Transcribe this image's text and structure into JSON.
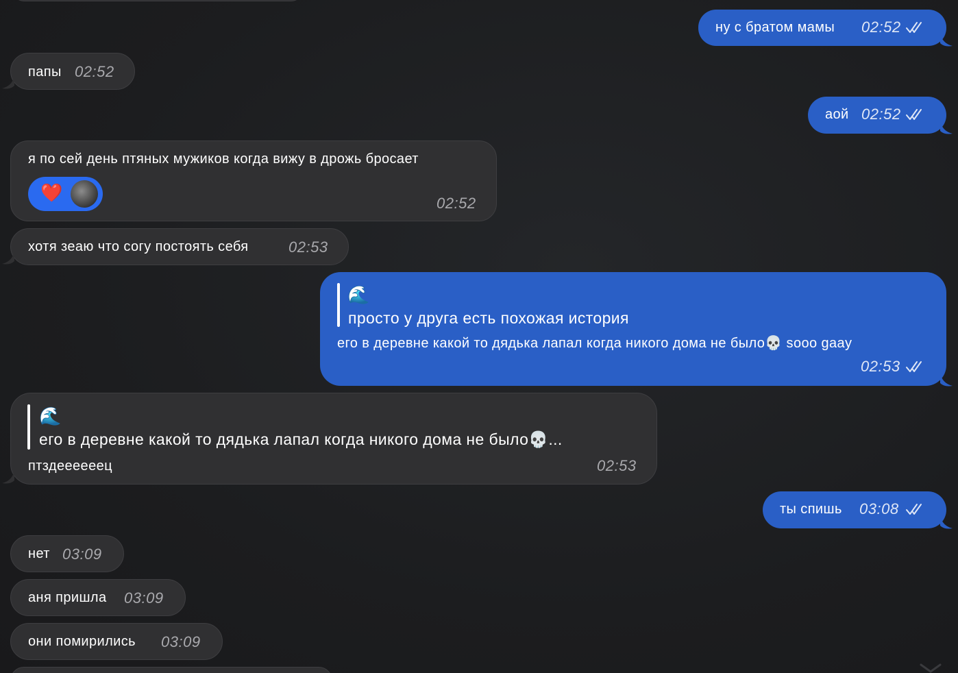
{
  "colors": {
    "background": "#1c1d1f",
    "incoming_bubble": "#303032",
    "outgoing_bubble": "#2a5fc6",
    "reaction_pill": "#2a6af0",
    "timestamp_in": "#a9a9ad",
    "timestamp_out": "#dfe7f7"
  },
  "messages": [
    {
      "direction": "out",
      "text": "ну с братом мамы",
      "time": "02:52",
      "status": "read"
    },
    {
      "direction": "in",
      "text": "папы",
      "time": "02:52"
    },
    {
      "direction": "out",
      "text": "аой",
      "time": "02:52",
      "status": "read"
    },
    {
      "direction": "in",
      "text": "я по сей день птяных мужиков когда вижу в дрожь бросает",
      "time": "02:52",
      "reactions": [
        "❤️",
        "avatar"
      ]
    },
    {
      "direction": "in",
      "text": "хотя зеаю что согу постоять себя",
      "time": "02:53"
    },
    {
      "direction": "out",
      "quote_emoji": "🌊",
      "quote_text": "просто у друга есть похожая история",
      "text": "его в деревне какой то дядька лапал когда никого дома не было💀 sooo gaay",
      "time": "02:53",
      "status": "read"
    },
    {
      "direction": "in",
      "quote_emoji": "🌊",
      "quote_text": "его в деревне какой то дядька лапал когда никого дома не было💀...",
      "text": "птздеееееец",
      "time": "02:53"
    },
    {
      "direction": "out",
      "text": "ты спишь",
      "time": "03:08",
      "status": "read"
    },
    {
      "direction": "in",
      "text": "нет",
      "time": "03:09"
    },
    {
      "direction": "in",
      "text": "аня пришла",
      "time": "03:09"
    },
    {
      "direction": "in",
      "text": "они помирились",
      "time": "03:09"
    }
  ]
}
